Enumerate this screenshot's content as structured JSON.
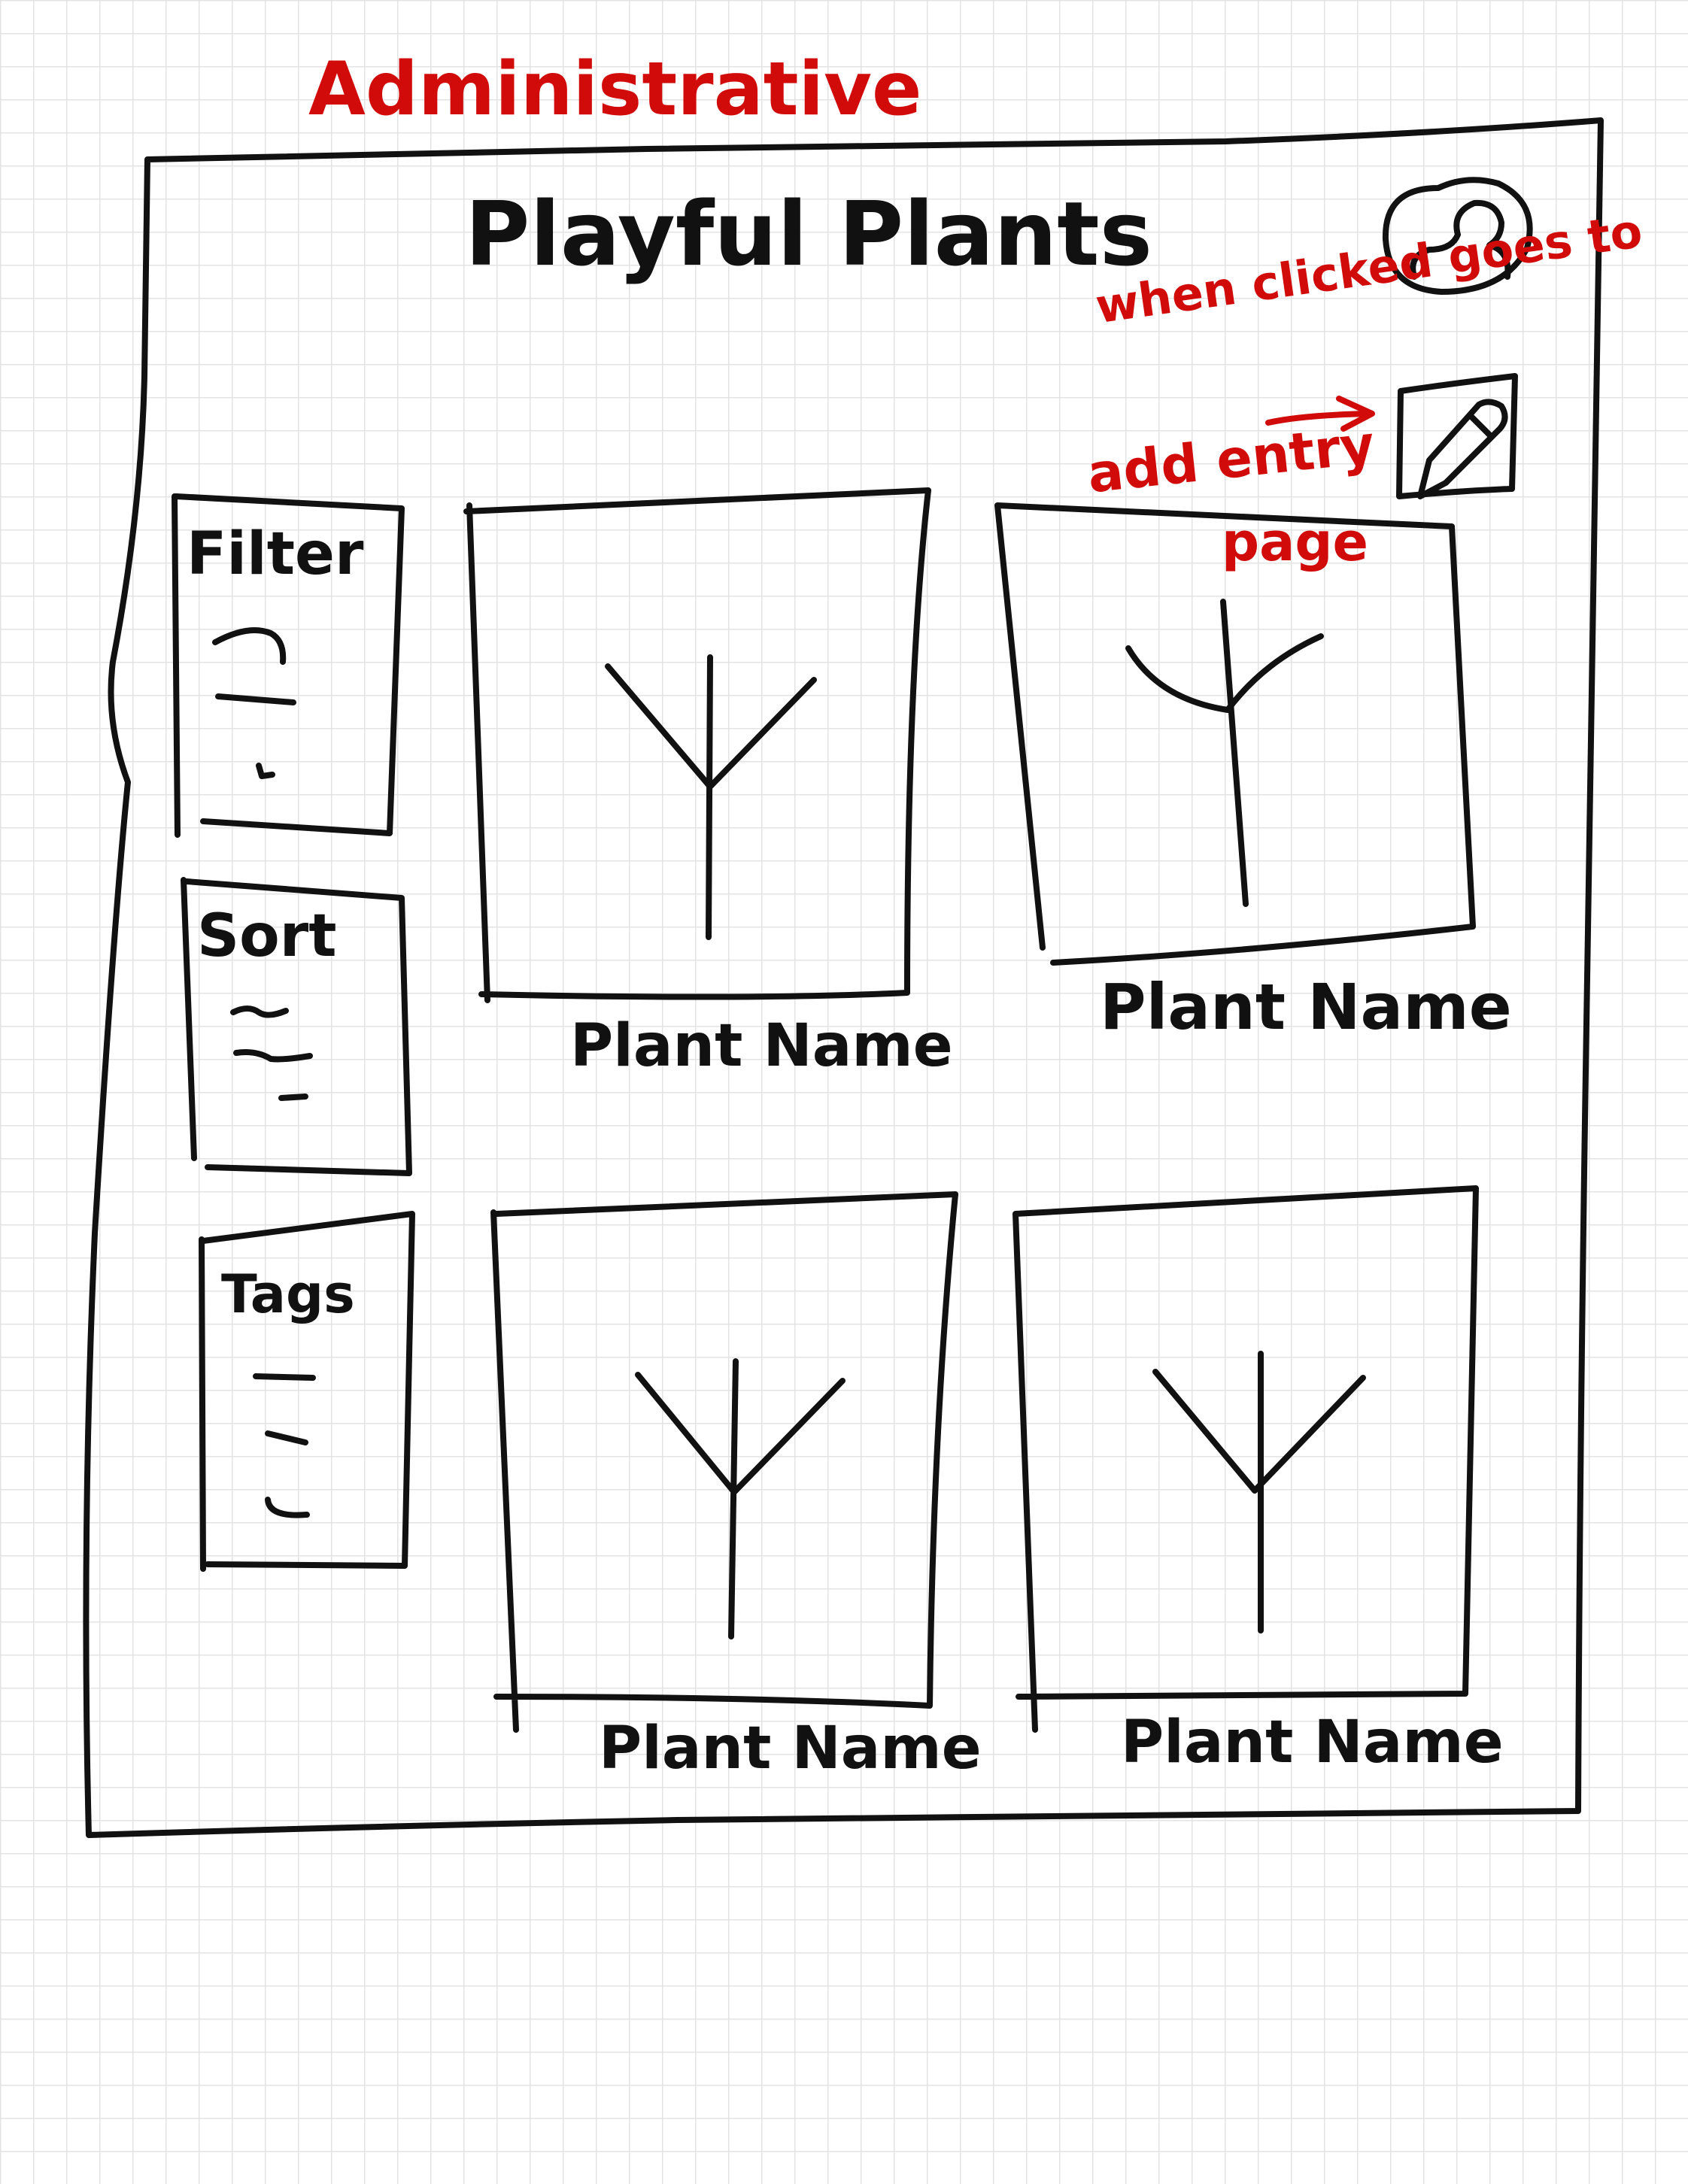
{
  "annotation": {
    "heading": "Administrative",
    "note_line1": "when clicked goes to",
    "note_line2": "add entry",
    "note_line3": "page"
  },
  "app": {
    "title": "Playful Plants"
  },
  "sidebar": {
    "filter": {
      "label": "Filter"
    },
    "sort": {
      "label": "Sort"
    },
    "tags": {
      "label": "Tags"
    }
  },
  "cards": [
    {
      "label": "Plant Name"
    },
    {
      "label": "Plant Name"
    },
    {
      "label": "Plant Name"
    },
    {
      "label": "Plant Name"
    }
  ],
  "icons": {
    "profile": "user-profile-icon",
    "edit": "pencil-edit-icon",
    "arrow": "arrow-right-icon",
    "plant": "plant-icon"
  },
  "colors": {
    "ink": "#111111",
    "annotation": "#d10a0a",
    "grid": "#e3e3e3"
  }
}
